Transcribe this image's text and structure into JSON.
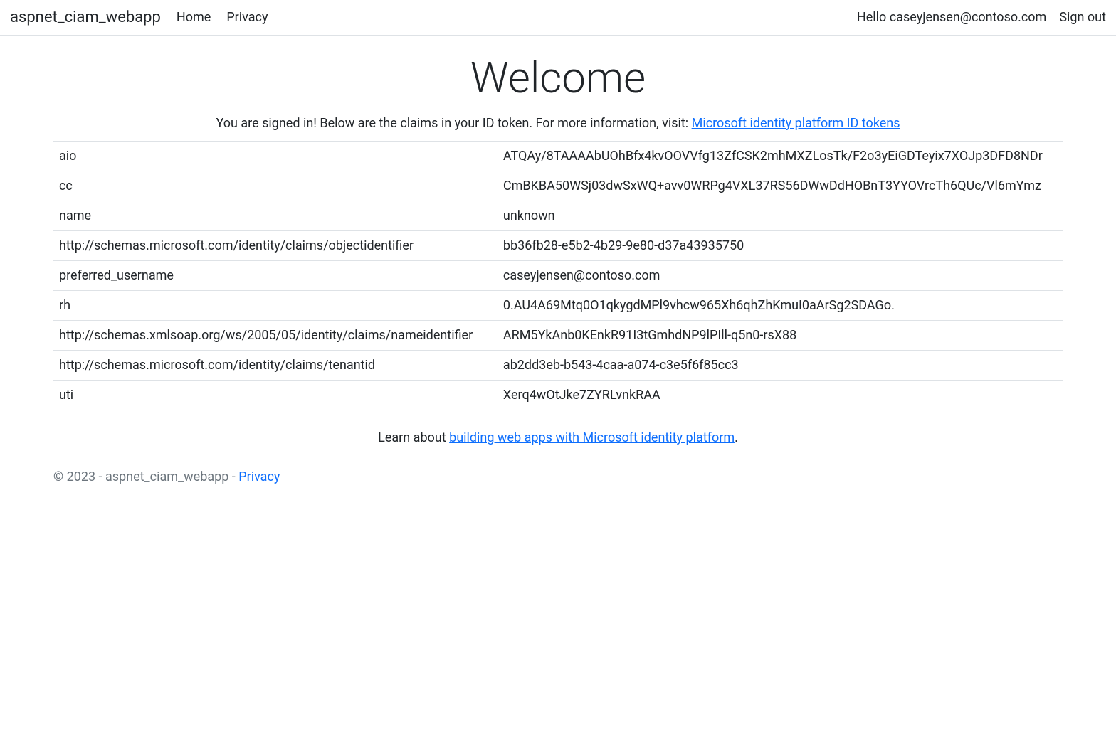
{
  "nav": {
    "brand": "aspnet_ciam_webapp",
    "home": "Home",
    "privacy": "Privacy",
    "greeting": "Hello caseyjensen@contoso.com",
    "signout": "Sign out"
  },
  "page": {
    "title": "Welcome",
    "intro_prefix": "You are signed in! Below are the claims in your ID token. For more information, visit: ",
    "intro_link": "Microsoft identity platform ID tokens",
    "learn_prefix": "Learn about ",
    "learn_link": "building web apps with Microsoft identity platform",
    "learn_suffix": "."
  },
  "claims": [
    {
      "key": "aio",
      "value": "ATQAy/8TAAAAbUOhBfx4kvOOVVfg13ZfCSK2mhMXZLosTk/F2o3yEiGDTeyix7XOJp3DFD8NDr"
    },
    {
      "key": "cc",
      "value": "CmBKBA50WSj03dwSxWQ+avv0WRPg4VXL37RS56DWwDdHOBnT3YYOVrcTh6QUc/Vl6mYmz"
    },
    {
      "key": "name",
      "value": "unknown"
    },
    {
      "key": "http://schemas.microsoft.com/identity/claims/objectidentifier",
      "value": "bb36fb28-e5b2-4b29-9e80-d37a43935750"
    },
    {
      "key": "preferred_username",
      "value": "caseyjensen@contoso.com"
    },
    {
      "key": "rh",
      "value": "0.AU4A69Mtq0O1qkygdMPl9vhcw965Xh6qhZhKmuI0aArSg2SDAGo."
    },
    {
      "key": "http://schemas.xmlsoap.org/ws/2005/05/identity/claims/nameidentifier",
      "value": "ARM5YkAnb0KEnkR91I3tGmhdNP9lPIll-q5n0-rsX88"
    },
    {
      "key": "http://schemas.microsoft.com/identity/claims/tenantid",
      "value": "ab2dd3eb-b543-4caa-a074-c3e5f6f85cc3"
    },
    {
      "key": "uti",
      "value": "Xerq4wOtJke7ZYRLvnkRAA"
    }
  ],
  "footer": {
    "text": "© 2023 - aspnet_ciam_webapp - ",
    "privacy": "Privacy"
  }
}
